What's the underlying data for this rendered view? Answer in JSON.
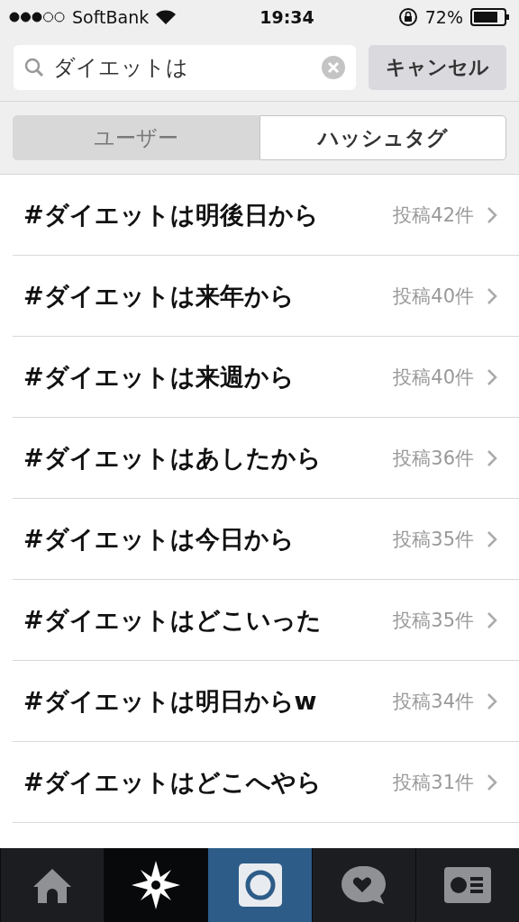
{
  "status_bar": {
    "carrier": "SoftBank",
    "time": "19:34",
    "battery": "72%"
  },
  "search": {
    "value": "ダイエットは",
    "cancel": "キャンセル"
  },
  "segments": [
    {
      "label": "ユーザー",
      "selected": false
    },
    {
      "label": "ハッシュタグ",
      "selected": true
    }
  ],
  "results": [
    {
      "tag": "#ダイエットは明後日から",
      "count": "投稿42件"
    },
    {
      "tag": "#ダイエットは来年から",
      "count": "投稿40件"
    },
    {
      "tag": "#ダイエットは来週から",
      "count": "投稿40件"
    },
    {
      "tag": "#ダイエットはあしたから",
      "count": "投稿36件"
    },
    {
      "tag": "#ダイエットは今日から",
      "count": "投稿35件"
    },
    {
      "tag": "#ダイエットはどこいった",
      "count": "投稿35件"
    },
    {
      "tag": "#ダイエットは明日からw",
      "count": "投稿34件"
    },
    {
      "tag": "#ダイエットはどこへやら",
      "count": "投稿31件"
    }
  ],
  "tab_bar": [
    {
      "kind": "home",
      "selected": false
    },
    {
      "kind": "explore",
      "selected": true
    },
    {
      "kind": "camera",
      "selected": false
    },
    {
      "kind": "activity",
      "selected": false
    },
    {
      "kind": "profile",
      "selected": false
    }
  ]
}
